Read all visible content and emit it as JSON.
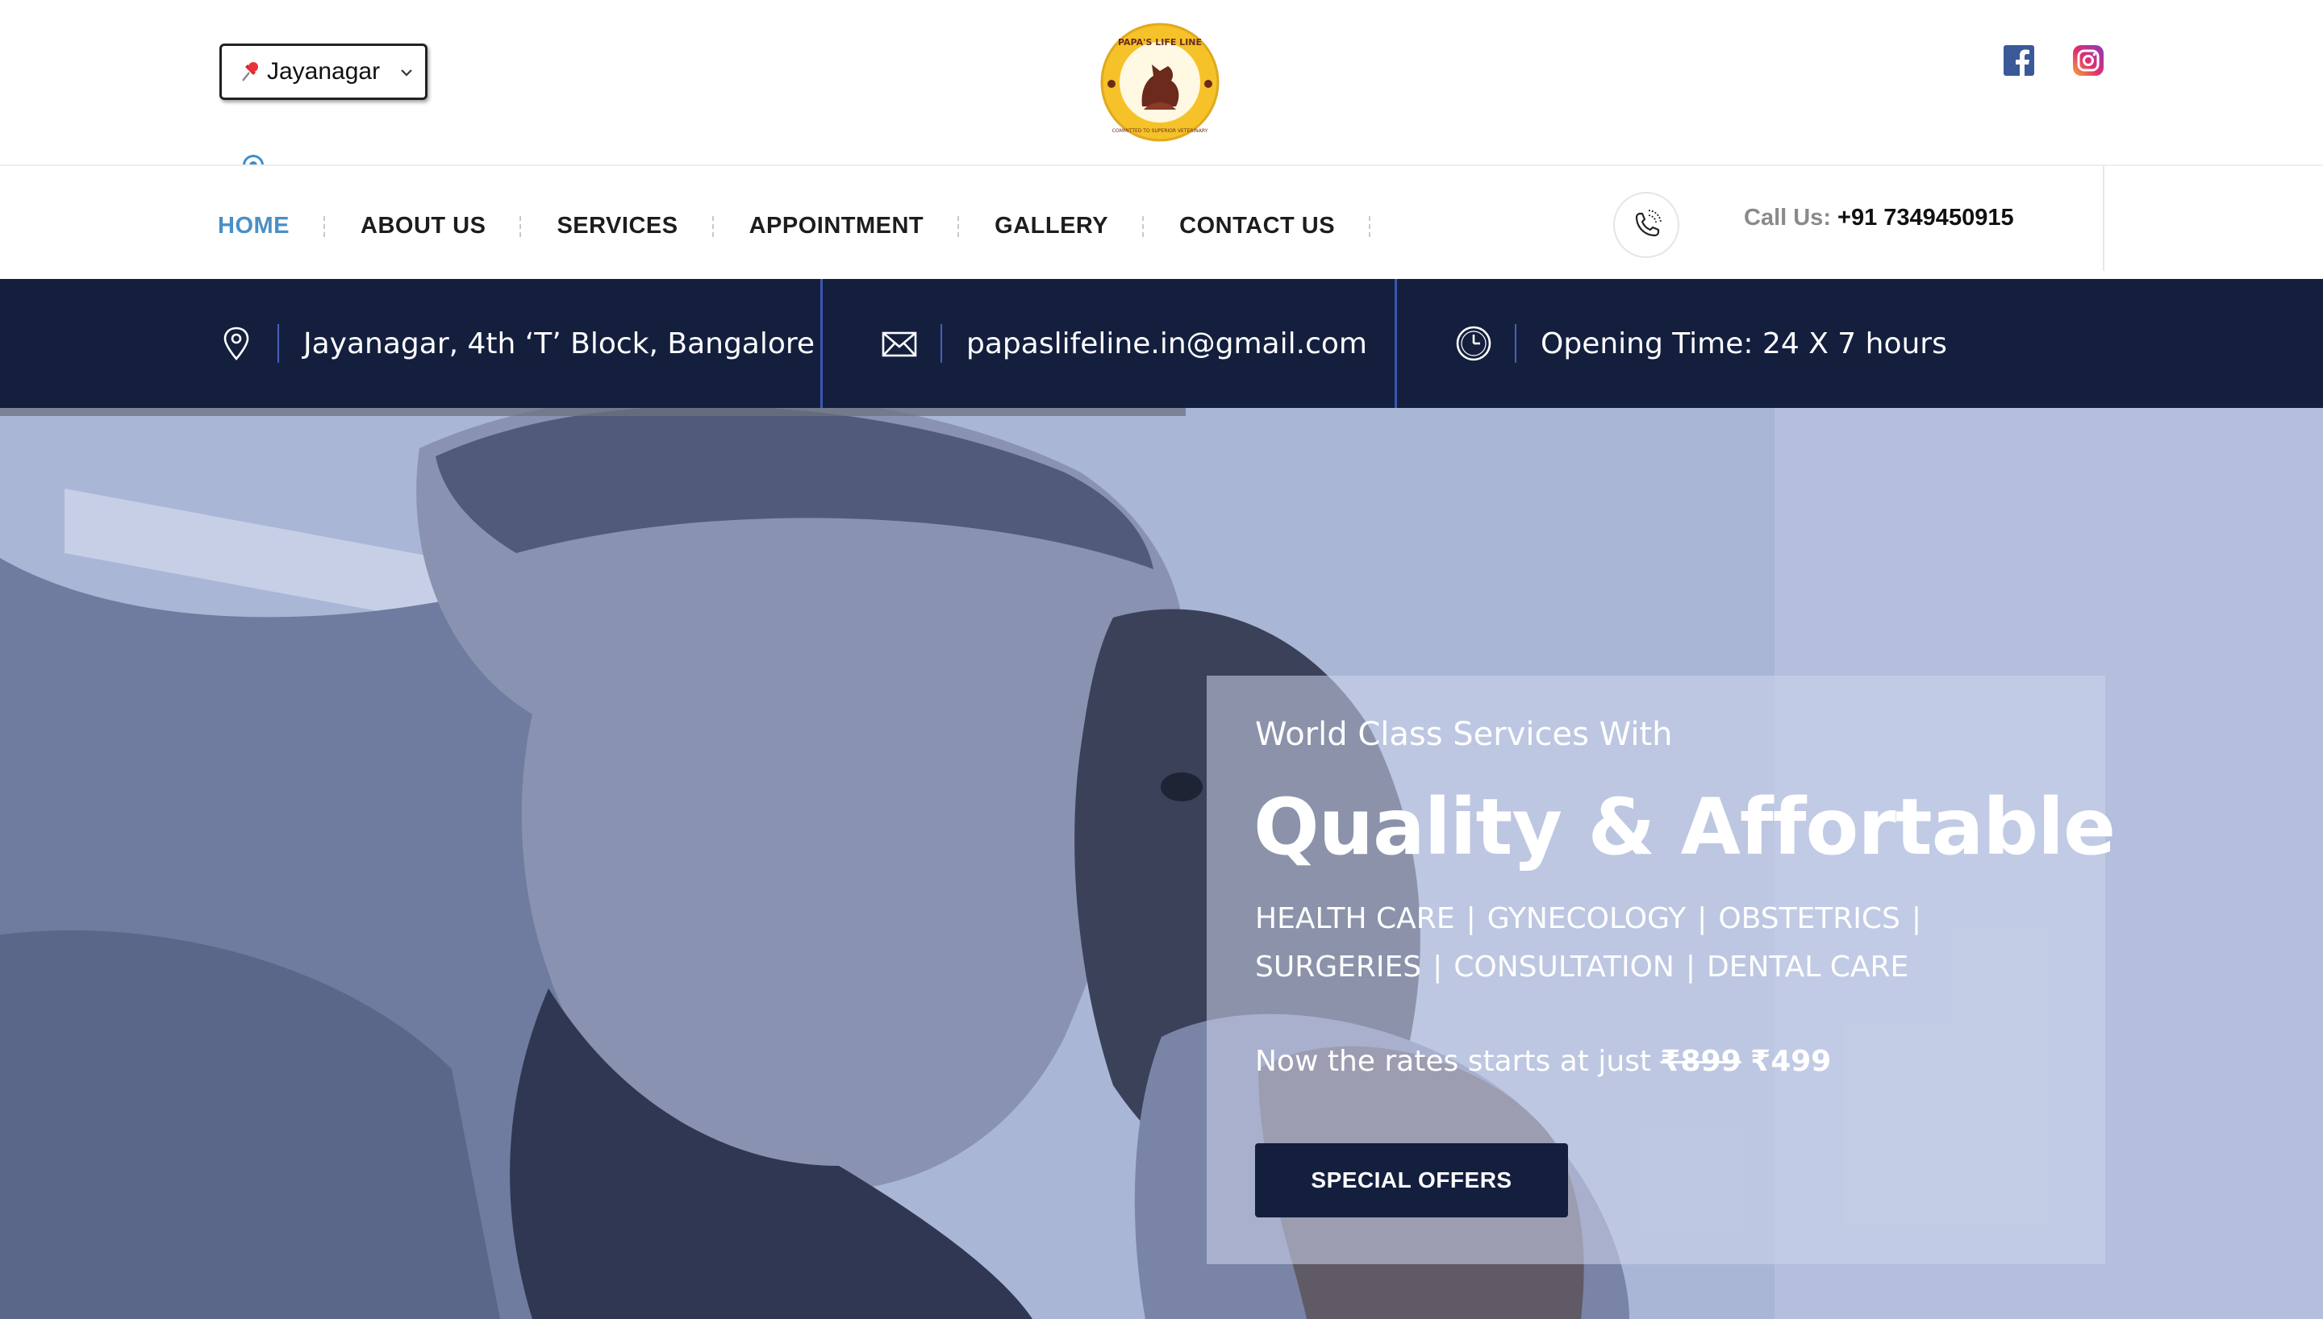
{
  "header": {
    "location_select": {
      "selected": "Jayanagar",
      "icon": "pin-icon"
    },
    "logo": {
      "icon": "papas-life-line-logo",
      "text": "PAPA'S LIFE LINE",
      "tagline": "COMMITTED TO SUPERIOR VETERINARY"
    },
    "social": {
      "facebook_icon": "facebook-icon",
      "instagram_icon": "instagram-icon"
    }
  },
  "nav": {
    "items": [
      {
        "label": "HOME",
        "active": true
      },
      {
        "label": "ABOUT US"
      },
      {
        "label": "SERVICES"
      },
      {
        "label": "APPOINTMENT"
      },
      {
        "label": "GALLERY"
      },
      {
        "label": "CONTACT US"
      }
    ],
    "call_label": "Call Us:",
    "call_number": "+91 7349450915"
  },
  "info": {
    "address": "Jayanagar, 4th ‘T’ Block, Bangalore",
    "email": "papaslifeline.in@gmail.com",
    "hours": "Opening Time: 24 X 7 hours"
  },
  "hero": {
    "kicker": "World Class Services With",
    "title": "Quality & Affortable",
    "services_line1": [
      "HEALTH CARE",
      "GYNECOLOGY",
      "OBSTETRICS"
    ],
    "services_line2": [
      "SURGERIES",
      "CONSULTATION",
      "DENTAL CARE"
    ],
    "rates_prefix": "Now the rates starts at just",
    "old_price": "₹899",
    "new_price": "₹499",
    "button": "SPECIAL OFFERS"
  },
  "colors": {
    "navy": "#141f3e",
    "accent_blue": "#4a8fc6",
    "hero_tint": "#a9b6d6"
  }
}
